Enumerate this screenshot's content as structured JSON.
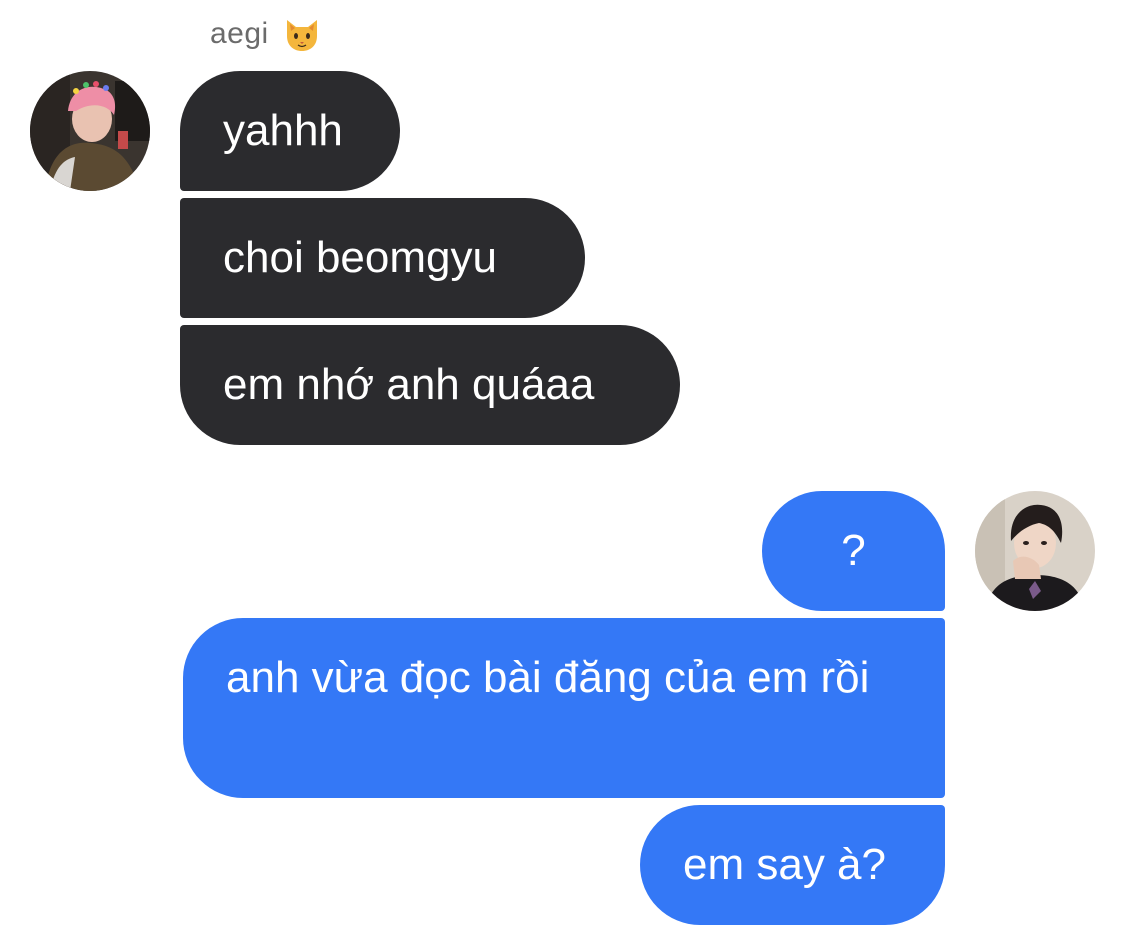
{
  "sender": {
    "name": "aegi",
    "emoji_icon": "cat-face-icon"
  },
  "incoming_messages": [
    {
      "text": "yahhh"
    },
    {
      "text": "choi beomgyu"
    },
    {
      "text": "em nhớ anh quáaa"
    }
  ],
  "outgoing_messages": [
    {
      "text": "?"
    },
    {
      "text": "anh vừa đọc bài đăng của em rồi"
    },
    {
      "text": "em say à?"
    }
  ],
  "colors": {
    "incoming_bubble": "#2b2b2e",
    "outgoing_bubble": "#3478f6",
    "sender_name": "#6b6b6b",
    "background": "#ffffff"
  }
}
